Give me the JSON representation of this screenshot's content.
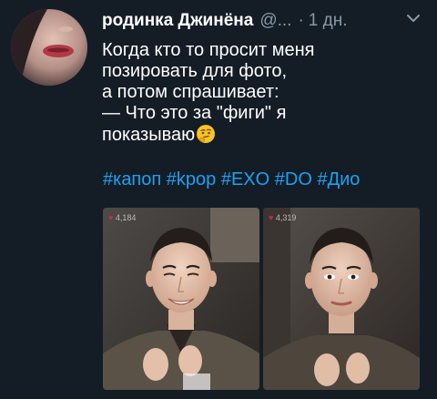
{
  "tweet": {
    "display_name": "родинка Джинёна",
    "handle": "@...",
    "separator": "·",
    "time": "1 дн.",
    "text_lines": [
      "Когда кто то просит меня",
      "позировать для фото,",
      "а потом спрашивает:",
      "— Что это за \"фиги\" я",
      "показываю"
    ],
    "emoji": "thinking-face",
    "hashtags": [
      "#капоп",
      "#kpop",
      "#EXO",
      "#DO",
      "#Дио"
    ]
  },
  "photos": [
    {
      "likes": "4,184",
      "description_icon": "photo"
    },
    {
      "likes": "4,319",
      "description_icon": "photo"
    }
  ],
  "colors": {
    "background": "#141d26",
    "text": "#ffffff",
    "secondary": "#8899a6",
    "link": "#1da1f2"
  }
}
